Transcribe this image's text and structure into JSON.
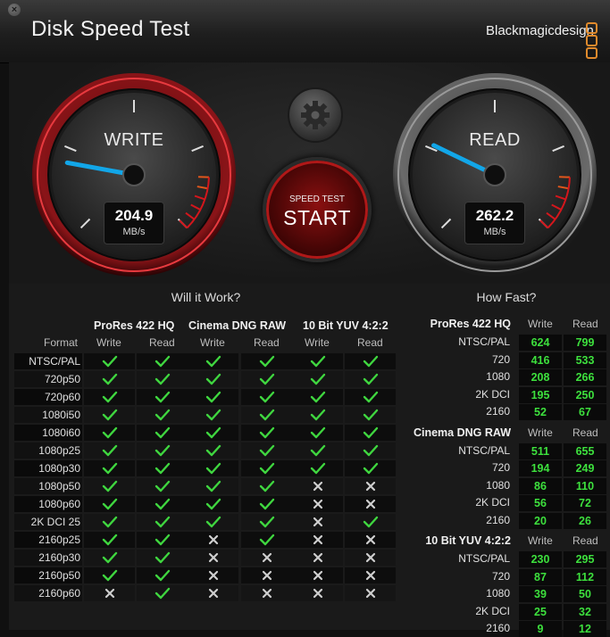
{
  "window": {
    "title": "Disk Speed Test",
    "brand": "Blackmagicdesign"
  },
  "gauges": {
    "write": {
      "label": "WRITE",
      "value": "204.9",
      "unit": "MB/s",
      "mb_s": 204.9
    },
    "read": {
      "label": "READ",
      "value": "262.2",
      "unit": "MB/s",
      "mb_s": 262.2
    }
  },
  "start_button": {
    "small": "SPEED TEST",
    "big": "START"
  },
  "will_it_work": {
    "title": "Will it Work?",
    "format_header": "Format",
    "codecs": [
      "ProRes 422 HQ",
      "Cinema DNG RAW",
      "10 Bit YUV 4:2:2"
    ],
    "subheaders": [
      "Write",
      "Read",
      "Write",
      "Read",
      "Write",
      "Read"
    ],
    "rows": [
      {
        "format": "NTSC/PAL",
        "ok": [
          1,
          1,
          1,
          1,
          1,
          1
        ]
      },
      {
        "format": "720p50",
        "ok": [
          1,
          1,
          1,
          1,
          1,
          1
        ]
      },
      {
        "format": "720p60",
        "ok": [
          1,
          1,
          1,
          1,
          1,
          1
        ]
      },
      {
        "format": "1080i50",
        "ok": [
          1,
          1,
          1,
          1,
          1,
          1
        ]
      },
      {
        "format": "1080i60",
        "ok": [
          1,
          1,
          1,
          1,
          1,
          1
        ]
      },
      {
        "format": "1080p25",
        "ok": [
          1,
          1,
          1,
          1,
          1,
          1
        ]
      },
      {
        "format": "1080p30",
        "ok": [
          1,
          1,
          1,
          1,
          1,
          1
        ]
      },
      {
        "format": "1080p50",
        "ok": [
          1,
          1,
          1,
          1,
          0,
          0
        ]
      },
      {
        "format": "1080p60",
        "ok": [
          1,
          1,
          1,
          1,
          0,
          0
        ]
      },
      {
        "format": "2K DCI 25",
        "ok": [
          1,
          1,
          1,
          1,
          0,
          1
        ]
      },
      {
        "format": "2160p25",
        "ok": [
          1,
          1,
          0,
          1,
          0,
          0
        ]
      },
      {
        "format": "2160p30",
        "ok": [
          1,
          1,
          0,
          0,
          0,
          0
        ]
      },
      {
        "format": "2160p50",
        "ok": [
          1,
          1,
          0,
          0,
          0,
          0
        ]
      },
      {
        "format": "2160p60",
        "ok": [
          0,
          1,
          0,
          0,
          0,
          0
        ]
      }
    ]
  },
  "how_fast": {
    "title": "How Fast?",
    "groups": [
      {
        "codec": "ProRes 422 HQ",
        "write_label": "Write",
        "read_label": "Read",
        "rows": [
          {
            "format": "NTSC/PAL",
            "write": "624",
            "read": "799"
          },
          {
            "format": "720",
            "write": "416",
            "read": "533"
          },
          {
            "format": "1080",
            "write": "208",
            "read": "266"
          },
          {
            "format": "2K DCI",
            "write": "195",
            "read": "250"
          },
          {
            "format": "2160",
            "write": "52",
            "read": "67"
          }
        ]
      },
      {
        "codec": "Cinema DNG RAW",
        "write_label": "Write",
        "read_label": "Read",
        "rows": [
          {
            "format": "NTSC/PAL",
            "write": "511",
            "read": "655"
          },
          {
            "format": "720",
            "write": "194",
            "read": "249"
          },
          {
            "format": "1080",
            "write": "86",
            "read": "110"
          },
          {
            "format": "2K DCI",
            "write": "56",
            "read": "72"
          },
          {
            "format": "2160",
            "write": "20",
            "read": "26"
          }
        ]
      },
      {
        "codec": "10 Bit YUV 4:2:2",
        "write_label": "Write",
        "read_label": "Read",
        "rows": [
          {
            "format": "NTSC/PAL",
            "write": "230",
            "read": "295"
          },
          {
            "format": "720",
            "write": "87",
            "read": "112"
          },
          {
            "format": "1080",
            "write": "39",
            "read": "50"
          },
          {
            "format": "2K DCI",
            "write": "25",
            "read": "32"
          },
          {
            "format": "2160",
            "write": "9",
            "read": "12"
          }
        ]
      }
    ]
  },
  "colors": {
    "ok": "#3fd63f",
    "fail": "#cfcfcf",
    "number": "#3de03d",
    "write_ring": "#c8232a",
    "needle": "#12a6e8",
    "brand_accent": "#e08a2c"
  }
}
